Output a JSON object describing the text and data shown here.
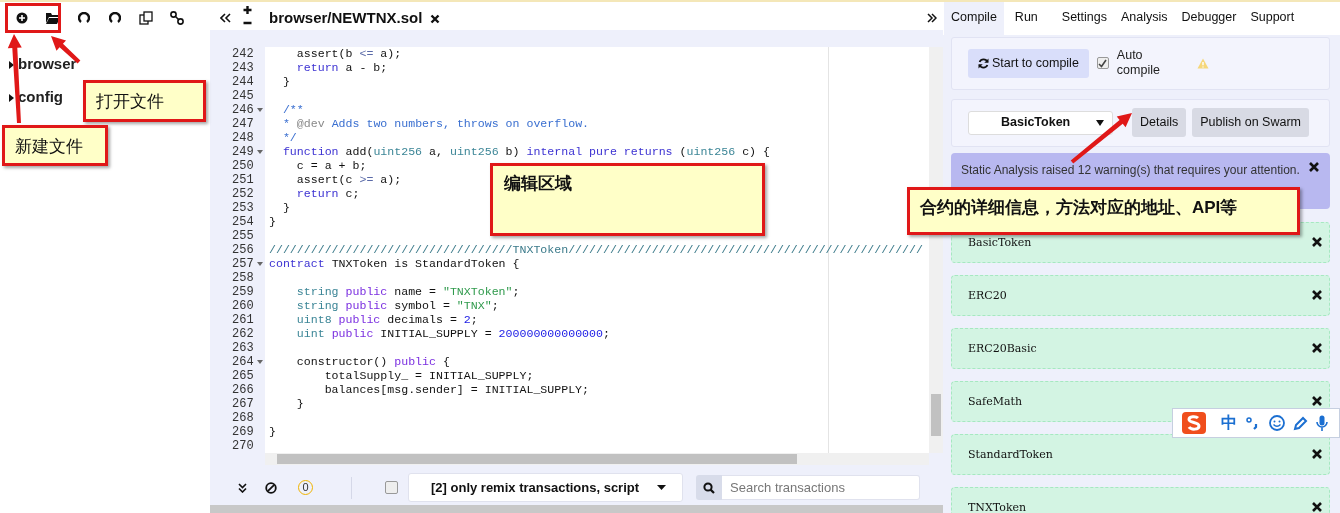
{
  "left_toolbar": {
    "highlighted": true
  },
  "file_tree": [
    {
      "label": "browser",
      "expanded": false
    },
    {
      "label": "config",
      "expanded": false
    }
  ],
  "editor": {
    "tab": {
      "label": "browser/NEWTNX.sol"
    },
    "lines": [
      {
        "num": "242",
        "fold": false,
        "t": [
          {
            "text": "    assert(b ",
            "kind": "plain"
          },
          {
            "text": "<=",
            "kind": "operator"
          },
          {
            "text": " a);",
            "kind": "plain"
          }
        ]
      },
      {
        "num": "243",
        "fold": false,
        "t": [
          {
            "text": "    return",
            "kind": "keyword"
          },
          {
            "text": " a - b;",
            "kind": "plain"
          }
        ]
      },
      {
        "num": "244",
        "fold": false,
        "t": [
          {
            "text": "  }",
            "kind": "plain"
          }
        ]
      },
      {
        "num": "245",
        "fold": false
      },
      {
        "num": "246",
        "fold": true,
        "t": [
          {
            "text": "  /**",
            "kind": "comment"
          }
        ]
      },
      {
        "num": "247",
        "fold": false,
        "t": [
          {
            "text": "  * ",
            "kind": "comment"
          },
          {
            "text": "@dev",
            "kind": "doctag"
          },
          {
            "text": " Adds two numbers, throws on overflow.",
            "kind": "comment"
          }
        ]
      },
      {
        "num": "248",
        "fold": false,
        "t": [
          {
            "text": "  */",
            "kind": "comment"
          }
        ]
      },
      {
        "num": "249",
        "fold": true,
        "t": [
          {
            "text": "  function",
            "kind": "keyword"
          },
          {
            "text": " add(",
            "kind": "plain"
          },
          {
            "text": "uint256",
            "kind": "type"
          },
          {
            "text": " a, ",
            "kind": "plain"
          },
          {
            "text": "uint256",
            "kind": "type"
          },
          {
            "text": " b) ",
            "kind": "plain"
          },
          {
            "text": "internal pure returns",
            "kind": "keyword"
          },
          {
            "text": " (",
            "kind": "plain"
          },
          {
            "text": "uint256",
            "kind": "type"
          },
          {
            "text": " c) {",
            "kind": "plain"
          }
        ]
      },
      {
        "num": "250",
        "fold": false,
        "t": [
          {
            "text": "    c = a + b;",
            "kind": "plain"
          }
        ]
      },
      {
        "num": "251",
        "fold": false,
        "t": [
          {
            "text": "    assert(c ",
            "kind": "plain"
          },
          {
            "text": ">=",
            "kind": "operator"
          },
          {
            "text": " a);",
            "kind": "plain"
          }
        ]
      },
      {
        "num": "252",
        "fold": false,
        "t": [
          {
            "text": "    return",
            "kind": "keyword"
          },
          {
            "text": " c;",
            "kind": "plain"
          }
        ]
      },
      {
        "num": "253",
        "fold": false,
        "t": [
          {
            "text": "  }",
            "kind": "plain"
          }
        ]
      },
      {
        "num": "254",
        "fold": false,
        "t": [
          {
            "text": "}",
            "kind": "plain"
          }
        ]
      },
      {
        "num": "255",
        "fold": false
      },
      {
        "num": "256",
        "fold": false,
        "t": [
          {
            "text": "///////////////////////////////////TNXToken///////////////////////////////////////////////////",
            "kind": "rule"
          }
        ]
      },
      {
        "num": "257",
        "fold": true,
        "t": [
          {
            "text": "contract",
            "kind": "keyword"
          },
          {
            "text": " TNXToken is StandardToken {",
            "kind": "plain"
          }
        ]
      },
      {
        "num": "258",
        "fold": false
      },
      {
        "num": "259",
        "fold": false,
        "t": [
          {
            "text": "    string",
            "kind": "type"
          },
          {
            "text": " public",
            "kind": "modifier"
          },
          {
            "text": " name = ",
            "kind": "plain"
          },
          {
            "text": "\"TNXToken\"",
            "kind": "string"
          },
          {
            "text": ";",
            "kind": "plain"
          }
        ]
      },
      {
        "num": "260",
        "fold": false,
        "t": [
          {
            "text": "    string",
            "kind": "type"
          },
          {
            "text": " public",
            "kind": "modifier"
          },
          {
            "text": " symbol = ",
            "kind": "plain"
          },
          {
            "text": "\"TNX\"",
            "kind": "string"
          },
          {
            "text": ";",
            "kind": "plain"
          }
        ]
      },
      {
        "num": "261",
        "fold": false,
        "t": [
          {
            "text": "    uint8",
            "kind": "type"
          },
          {
            "text": " public",
            "kind": "modifier"
          },
          {
            "text": " decimals = ",
            "kind": "plain"
          },
          {
            "text": "2",
            "kind": "number"
          },
          {
            "text": ";",
            "kind": "plain"
          }
        ]
      },
      {
        "num": "262",
        "fold": false,
        "t": [
          {
            "text": "    uint",
            "kind": "type"
          },
          {
            "text": " public",
            "kind": "modifier"
          },
          {
            "text": " INITIAL_SUPPLY = ",
            "kind": "plain"
          },
          {
            "text": "200000000000000",
            "kind": "number"
          },
          {
            "text": ";",
            "kind": "plain"
          }
        ]
      },
      {
        "num": "263",
        "fold": false
      },
      {
        "num": "264",
        "fold": true,
        "t": [
          {
            "text": "    constructor() ",
            "kind": "plain"
          },
          {
            "text": "public",
            "kind": "modifier"
          },
          {
            "text": " {",
            "kind": "plain"
          }
        ]
      },
      {
        "num": "265",
        "fold": false,
        "t": [
          {
            "text": "        totalSupply_ = INITIAL_SUPPLY;",
            "kind": "plain"
          }
        ]
      },
      {
        "num": "266",
        "fold": false,
        "t": [
          {
            "text": "        balances[msg.sender] = INITIAL_SUPPLY;",
            "kind": "plain"
          }
        ]
      },
      {
        "num": "267",
        "fold": false,
        "t": [
          {
            "text": "    }",
            "kind": "plain"
          }
        ]
      },
      {
        "num": "268",
        "fold": false
      },
      {
        "num": "269",
        "fold": false,
        "t": [
          {
            "text": "}",
            "kind": "plain"
          }
        ]
      },
      {
        "num": "270",
        "fold": false
      }
    ]
  },
  "terminal": {
    "counter": "0",
    "filter_checked": false,
    "filter": "[2] only remix transactions, script",
    "search": {
      "placeholder": "Search transactions"
    }
  },
  "right_tabs": [
    {
      "label": "Compile",
      "selected": true
    },
    {
      "label": "Run",
      "selected": false
    },
    {
      "label": "Settings",
      "selected": false
    },
    {
      "label": "Analysis",
      "selected": false
    },
    {
      "label": "Debugger",
      "selected": false
    },
    {
      "label": "Support",
      "selected": false
    }
  ],
  "compile": {
    "button": "Start to compile",
    "auto_compile": {
      "label": "Auto compile",
      "checked": true
    },
    "contract_select": "BasicToken",
    "buttons": [
      "Details",
      "Publish on Swarm"
    ],
    "warning": "Static Analysis raised 12 warning(s) that requires your attention.",
    "contracts": [
      "BasicToken",
      "ERC20",
      "ERC20Basic",
      "SafeMath",
      "StandardToken",
      "TNXToken"
    ]
  },
  "ime_toolbar": {
    "label": "中"
  },
  "annotations": [
    {
      "text": "打开文件"
    },
    {
      "text": "新建文件"
    },
    {
      "text": "编辑区域"
    },
    {
      "text": "合约的详细信息，方法对应的地址、API等"
    }
  ]
}
